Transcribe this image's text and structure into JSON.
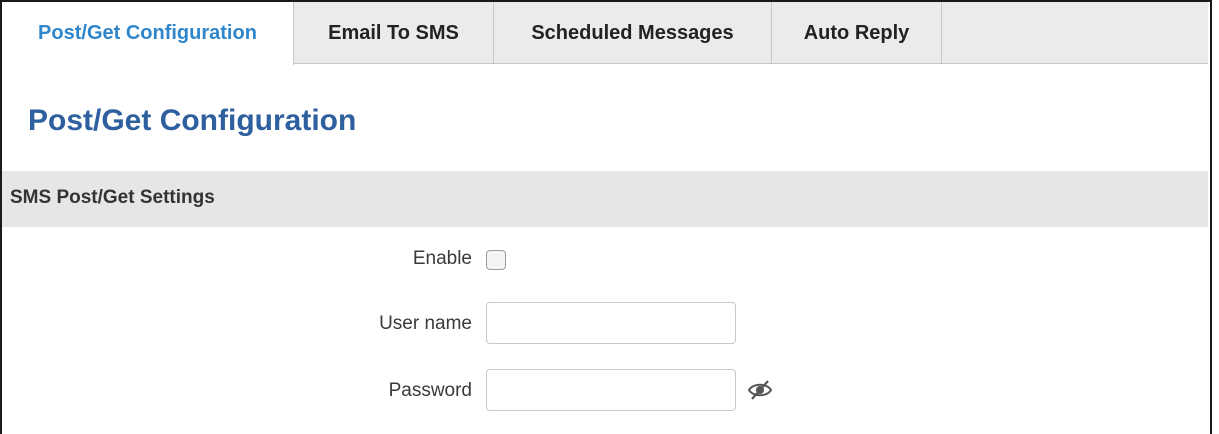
{
  "tabs": [
    {
      "label": "Post/Get Configuration",
      "active": true
    },
    {
      "label": "Email To SMS",
      "active": false
    },
    {
      "label": "Scheduled Messages",
      "active": false
    },
    {
      "label": "Auto Reply",
      "active": false
    }
  ],
  "page": {
    "title": "Post/Get Configuration"
  },
  "section": {
    "title": "SMS Post/Get Settings"
  },
  "form": {
    "enable_label": "Enable",
    "enable_checked": false,
    "username_label": "User name",
    "username_value": "",
    "password_label": "Password",
    "password_value": ""
  },
  "icons": {
    "password_toggle": "eye-slash-icon"
  },
  "colors": {
    "active_tab_text": "#2f86cb",
    "page_title": "#2e5f9e",
    "tabbar_bg": "#ebebeb",
    "section_bg": "#e6e6e6"
  }
}
